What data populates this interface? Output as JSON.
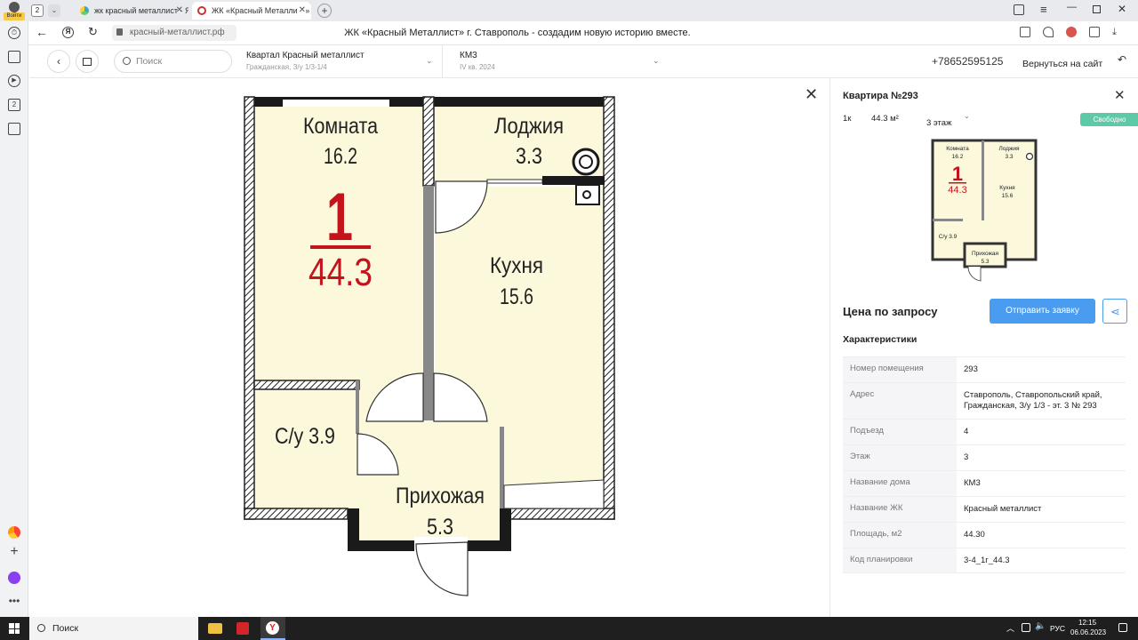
{
  "browser": {
    "tab_count": "2",
    "login_label": "Войти",
    "tabs": [
      {
        "label": "жк красный металлист - Я"
      },
      {
        "label": "ЖК «Красный Металлист»"
      }
    ],
    "new_tab": "+",
    "url": "красный-металлист.рф",
    "page_title": "ЖК «Красный Металлист» г. Ставрополь - создадим новую историю вместе."
  },
  "header": {
    "search_placeholder": "Поиск",
    "complex_name": "Квартал Красный металлист",
    "complex_address": "Гражданская, З/у 1/3-1/4",
    "building_name": "КМ3",
    "building_date": "IV кв. 2024",
    "phone": "+78652595125",
    "back_to_site": "Вернуться на сайт"
  },
  "plan": {
    "rooms": {
      "room": {
        "name": "Комната",
        "area": "16.2"
      },
      "loggia": {
        "name": "Лоджия",
        "area": "3.3"
      },
      "kitchen": {
        "name": "Кухня",
        "area": "15.6"
      },
      "bathroom": {
        "label": "С/у 3.9"
      },
      "hall": {
        "name": "Прихожая",
        "area": "5.3"
      }
    },
    "rooms_count": "1",
    "total_area": "44.3"
  },
  "details": {
    "title": "Квартира №293",
    "type": "1к",
    "area": "44.3 м²",
    "floor": "3 этаж",
    "status": "Свободно",
    "price": "Цена по запросу",
    "request_button": "Отправить заявку",
    "characteristics_title": "Характеристики",
    "rows": [
      {
        "k": "Номер помещения",
        "v": "293"
      },
      {
        "k": "Адрес",
        "v": "Ставрополь, Ставропольский край, Гражданская, З/у 1/3 - эт. 3 № 293"
      },
      {
        "k": "Подъезд",
        "v": "4"
      },
      {
        "k": "Этаж",
        "v": "3"
      },
      {
        "k": "Название дома",
        "v": "КМ3"
      },
      {
        "k": "Название ЖК",
        "v": "Красный металлист"
      },
      {
        "k": "Площадь, м2",
        "v": "44.30"
      },
      {
        "k": "Код планировки",
        "v": "3-4_1г_44.3"
      }
    ],
    "status_color": "#5dc9a7",
    "accent_color": "#4a9cf0"
  },
  "taskbar": {
    "search": "Поиск",
    "lang": "РУС",
    "time": "12:15",
    "date": "06.06.2023"
  }
}
